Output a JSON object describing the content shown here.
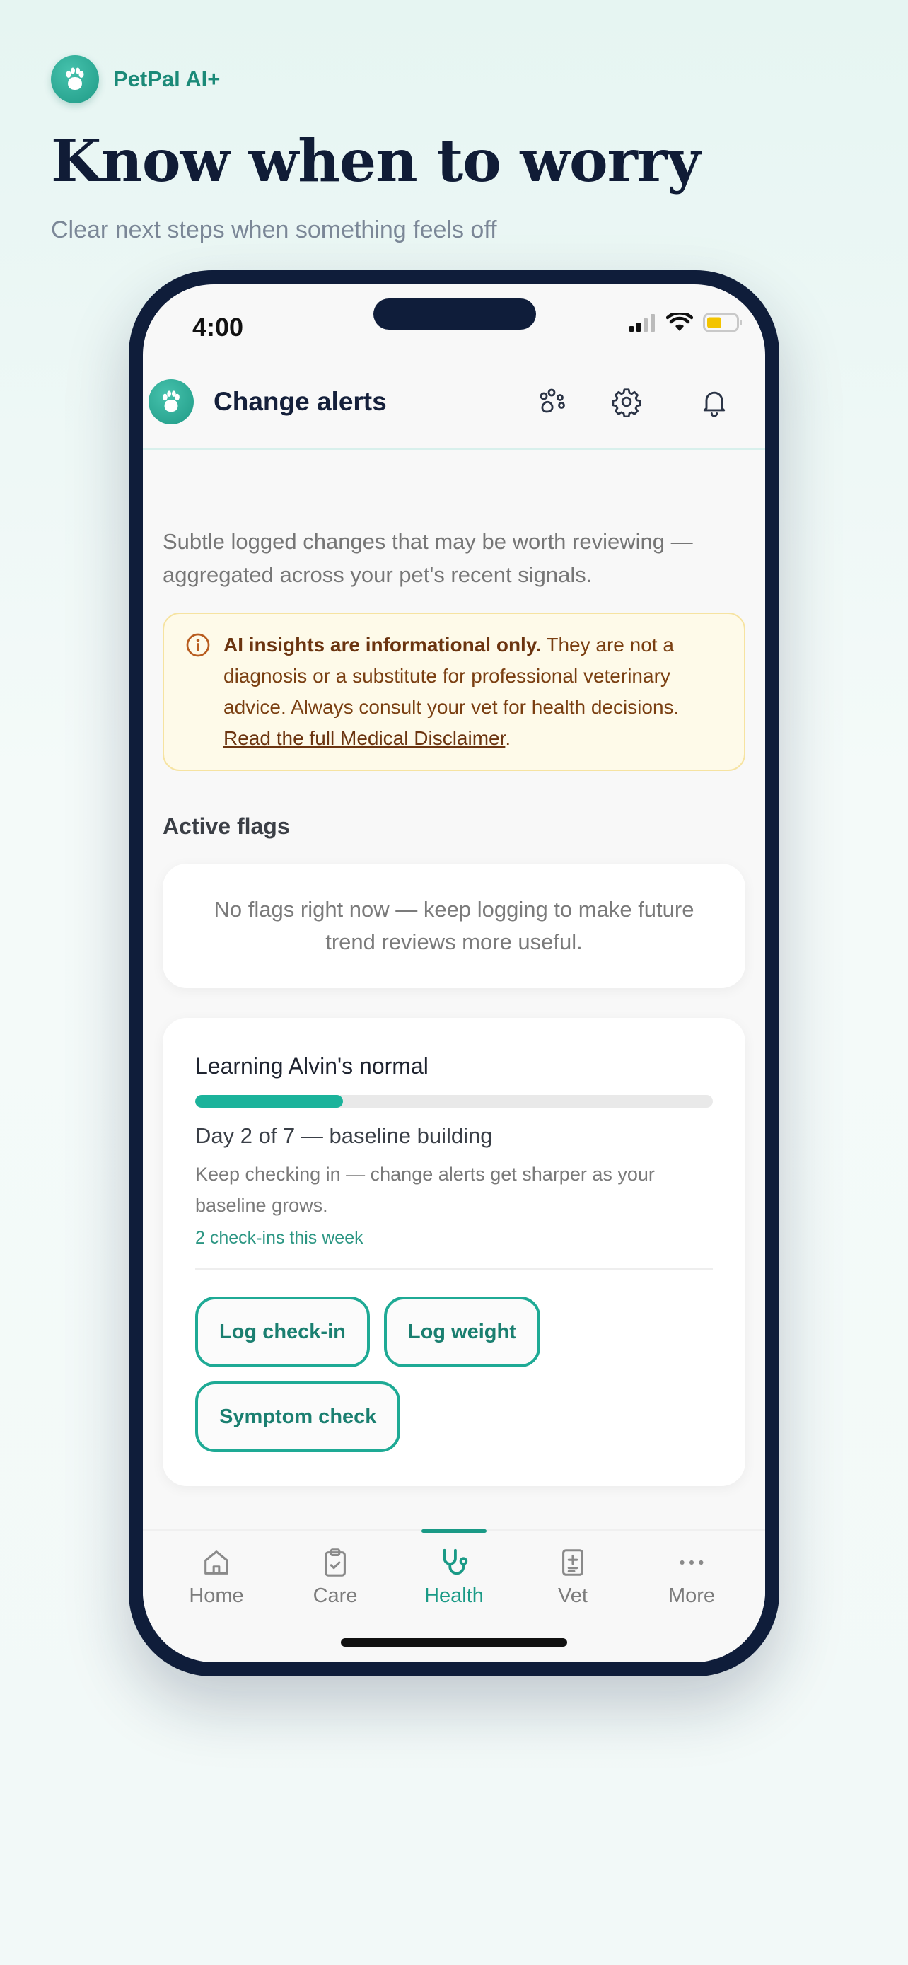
{
  "brand": {
    "name": "PetPal AI+"
  },
  "hero": {
    "headline": "Know when to worry",
    "subline": "Clear next steps when something feels off"
  },
  "status_bar": {
    "time": "4:00"
  },
  "app_bar": {
    "title": "Change alerts",
    "actions": [
      "paw-icon",
      "gear-icon",
      "bell-icon"
    ]
  },
  "intro": "Subtle logged changes that may be worth reviewing — aggregated across your pet's recent signals.",
  "disclaimer": {
    "bold": "AI insights are informational only.",
    "text": " They are not a diagnosis or a substitute for professional veterinary advice. Always consult your vet for health decisions. ",
    "link": "Read the full Medical Disclaimer",
    "end": "."
  },
  "active_flags": {
    "title": "Active flags",
    "empty_message": "No flags right now — keep logging to make future trend reviews more useful."
  },
  "learning": {
    "title": "Learning Alvin's normal",
    "progress_fraction": 0.2857,
    "status": "Day 2 of 7 — baseline building",
    "description": "Keep checking in — change alerts get sharper as your baseline grows.",
    "count": "2 check-ins this week",
    "buttons": [
      "Log check-in",
      "Log weight",
      "Symptom check"
    ]
  },
  "tabs": [
    {
      "label": "Home",
      "icon": "home-icon",
      "active": false
    },
    {
      "label": "Care",
      "icon": "clipboard-icon",
      "active": false
    },
    {
      "label": "Health",
      "icon": "stethoscope-icon",
      "active": true
    },
    {
      "label": "Vet",
      "icon": "medical-file-icon",
      "active": false
    },
    {
      "label": "More",
      "icon": "more-dots-icon",
      "active": false
    }
  ],
  "colors": {
    "accent": "#1a9a86",
    "navy": "#0f1d3a",
    "warning_bg": "#fefae9",
    "warning_text": "#7a3f12"
  }
}
